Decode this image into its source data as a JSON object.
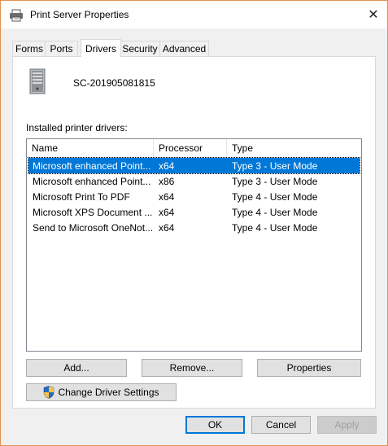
{
  "window": {
    "title": "Print Server Properties",
    "close_glyph": "✕"
  },
  "tabs": [
    {
      "label": "Forms"
    },
    {
      "label": "Ports"
    },
    {
      "label": "Drivers",
      "active": true
    },
    {
      "label": "Security"
    },
    {
      "label": "Advanced"
    }
  ],
  "server": {
    "name": "SC-201905081815"
  },
  "drivers": {
    "label": "Installed printer drivers:",
    "columns": [
      "Name",
      "Processor",
      "Type"
    ],
    "rows": [
      {
        "name": "Microsoft enhanced Point...",
        "processor": "x64",
        "type": "Type 3 - User Mode",
        "selected": true
      },
      {
        "name": "Microsoft enhanced Point...",
        "processor": "x86",
        "type": "Type 3 - User Mode"
      },
      {
        "name": "Microsoft Print To PDF",
        "processor": "x64",
        "type": "Type 4 - User Mode"
      },
      {
        "name": "Microsoft XPS Document ...",
        "processor": "x64",
        "type": "Type 4 - User Mode"
      },
      {
        "name": "Send to Microsoft OneNot...",
        "processor": "x64",
        "type": "Type 4 - User Mode"
      }
    ]
  },
  "buttons": {
    "add": "Add...",
    "remove": "Remove...",
    "properties": "Properties",
    "change_driver_settings": "Change Driver Settings",
    "ok": "OK",
    "cancel": "Cancel",
    "apply": "Apply"
  },
  "colors": {
    "selection": "#0078d7",
    "window_border": "#e2914f"
  }
}
